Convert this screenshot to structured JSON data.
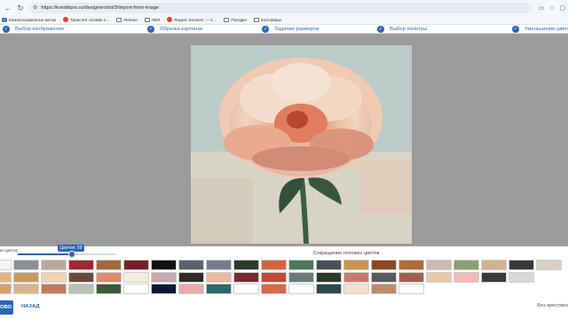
{
  "browser": {
    "url": "https://krestikpro.ru/designer/slot/3/import-from-image",
    "bookmarks": [
      {
        "label": "Компенсационные метки",
        "icon": "blue"
      },
      {
        "label": "Транслит онлайн п...",
        "icon": "red"
      },
      {
        "label": "Личное",
        "icon": "folder"
      },
      {
        "label": "ЛИЛ",
        "icon": "folder"
      },
      {
        "label": "Яндекс Коннект — С...",
        "icon": "red"
      },
      {
        "label": "Поездки",
        "icon": "folder"
      },
      {
        "label": "Зоотовары",
        "icon": "folder"
      }
    ]
  },
  "steps": [
    "Выбор изображения",
    "Обрезка картинки",
    "Задание размеров",
    "Выбор палитры",
    "Уменьшение цветов"
  ],
  "slider": {
    "label": "во цветов",
    "tooltip": "Цветов: 59",
    "value_fraction": 0.55
  },
  "reduce_title": "Сокращение похожих цветов",
  "palette": {
    "row1": [
      "#f5f5f5",
      "#8c9096",
      "#b9a998",
      "#a02830",
      "#a06a3a",
      "#7a1e26",
      "#111111",
      "#5a6270",
      "#7a7a90",
      "#2a3a2a",
      "#d8623a",
      "#4a7a5a",
      "#4a4e56",
      "#c8964e",
      "#8a4a20",
      "#b06a3a",
      "#cdbab0",
      "#8aa070",
      "#d4b090",
      "#3a3a3a",
      "#d8d0c4"
    ],
    "row2": [
      "#e0b880",
      "#c89a60",
      "#f0d2b0",
      "#6a4a3a",
      "#e08a70",
      "#f4ece0",
      "#c8aab0",
      "#302a2a",
      "#e8b8a0",
      "#7a2a2a",
      "#c04a38",
      "#6a7a7a",
      "#2a3a2a",
      "#c87a6a",
      "#5a5a5a",
      "#a06050",
      "#e8c8a8",
      "#f4b8b8",
      "#3a3a3a",
      "#d8d8d8"
    ],
    "row3": [
      "#d8a070",
      "#d8b48a",
      "#c07a5a",
      "#b8c0b4",
      "#3a5a3a",
      "#ffffff",
      "#0a1a3a",
      "#e8a8a8",
      "#2a6a6a",
      "#ffffff",
      "#d46a4a",
      "#ffffff",
      "#2a4a4a",
      "#f0e0d0",
      "#c08a6a",
      "#ffffff"
    ],
    "accent": "#2a66b8"
  },
  "buttons": {
    "next_partial": "ОВО",
    "back": "НАЗАД",
    "no_cross": "Без крестико"
  }
}
